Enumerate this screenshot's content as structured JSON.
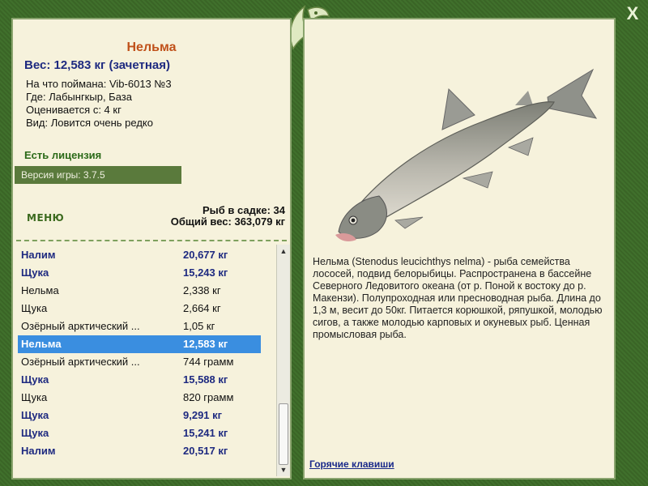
{
  "fish": {
    "name": "Нельма",
    "weight_line": "Вес: 12,583 кг (зачетная)",
    "caught_on": "На что поймана: Vib-6013 №3",
    "location": "Где: Лабынгкыр, База",
    "valued_from": "Оценивается с: 4 кг",
    "species_rarity": "Вид: Ловится очень редко"
  },
  "license": "Есть лицензия",
  "game_version": "Версия игры: 3.7.5",
  "menu_label": "МЕНЮ",
  "keep_net": {
    "count_text": "Рыб в садке: 34",
    "total_weight_text": "Общий вес: 363,079 кг"
  },
  "catch_list": [
    {
      "name": "Налим",
      "weight": "20,677 кг",
      "highlight": true
    },
    {
      "name": "Щука",
      "weight": "15,243 кг",
      "highlight": true
    },
    {
      "name": "Нельма",
      "weight": "2,338 кг",
      "highlight": false
    },
    {
      "name": "Щука",
      "weight": "2,664 кг",
      "highlight": false
    },
    {
      "name": "Озёрный арктический ...",
      "weight": "1,05 кг",
      "highlight": false
    },
    {
      "name": "Нельма",
      "weight": "12,583 кг",
      "highlight": true,
      "selected": true
    },
    {
      "name": "Озёрный арктический ...",
      "weight": "744 грамм",
      "highlight": false
    },
    {
      "name": "Щука",
      "weight": "15,588 кг",
      "highlight": true
    },
    {
      "name": "Щука",
      "weight": "820 грамм",
      "highlight": false
    },
    {
      "name": "Щука",
      "weight": "9,291 кг",
      "highlight": true
    },
    {
      "name": "Щука",
      "weight": "15,241 кг",
      "highlight": true
    },
    {
      "name": "Налим",
      "weight": "20,517 кг",
      "highlight": true
    }
  ],
  "description": "Нельма (Stenodus leucichthys nelma) - рыба семейства лососей, подвид белорыбицы. Распространена в бассейне Северного Ледовитого океана (от р. Поной к востоку до р. Макензи). Полупроходная или пресноводная рыба. Длина до 1,3 м, весит до 50кг. Питается корюшкой, ряпушкой, молодью сигов, а также молодью карповых и окуневых рыб. Ценная промысловая рыба.",
  "hotkeys_label": "Горячие клавиши",
  "close_label": "X",
  "icons": {
    "close": "close-icon",
    "logo": "leaf-logo-icon",
    "scroll_up": "arrow-up-icon",
    "scroll_down": "arrow-down-icon"
  },
  "colors": {
    "frame": "#3f6a2a",
    "panel": "#f6f2dc",
    "accent_title": "#c0511a",
    "highlight_text": "#1e2a80",
    "selected_row": "#3a8ee0"
  }
}
